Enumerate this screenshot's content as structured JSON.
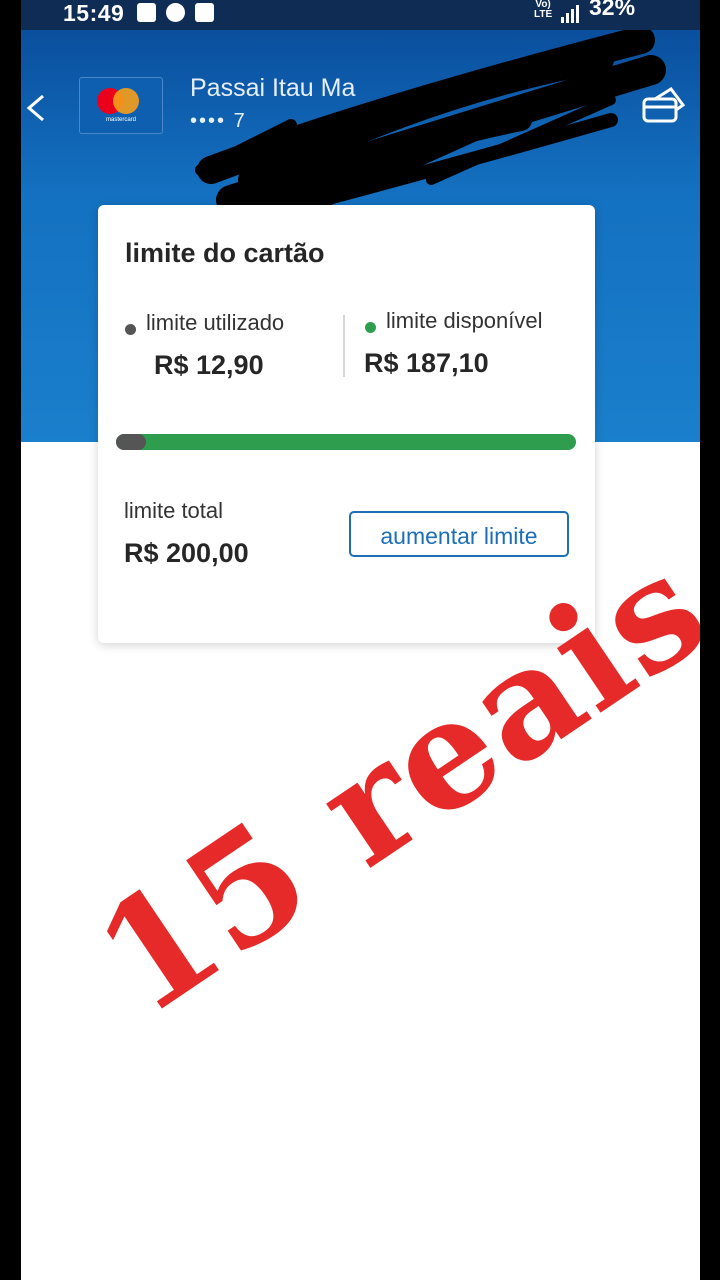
{
  "status_bar": {
    "time": "15:49",
    "network_label": "Vo) LTE",
    "battery": "32%"
  },
  "header": {
    "card_name": "Passai Itau Ma",
    "card_number_masked": "•••• 7",
    "card_brand": "mastercard",
    "brand_colors": {
      "red": "#eb001b",
      "orange": "#f79e1b"
    }
  },
  "limit_card": {
    "title": "limite do cartão",
    "used_label": "limite utilizado",
    "used_value": "R$ 12,90",
    "available_label": "limite disponível",
    "available_value": "R$ 187,10",
    "usage_fraction": 0.0645,
    "total_label": "limite total",
    "total_value": "R$ 200,00",
    "increase_button": "aumentar limite",
    "colors": {
      "used": "#555555",
      "available": "#2e9e4e",
      "accent": "#1c6fb6"
    }
  },
  "overlay": {
    "text": "15 reais",
    "color": "#e62a2a"
  }
}
